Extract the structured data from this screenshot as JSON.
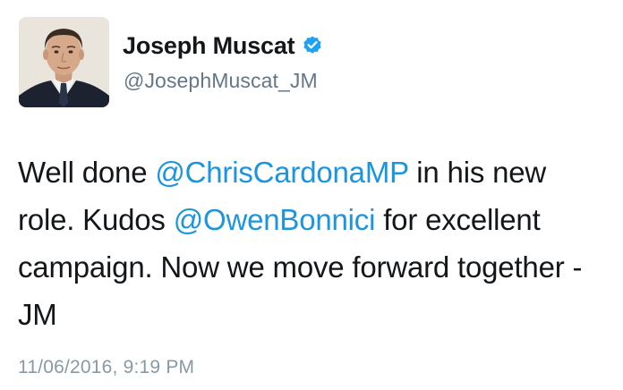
{
  "tweet": {
    "author": {
      "display_name": "Joseph Muscat",
      "handle": "@JosephMuscat_JM",
      "verified": true,
      "avatar_icon": "profile-photo"
    },
    "text_segments": [
      {
        "text": "Well done ",
        "type": "text"
      },
      {
        "text": "@ChrisCardonaMP",
        "type": "mention"
      },
      {
        "text": " in his new role. Kudos ",
        "type": "text"
      },
      {
        "text": "@OwenBonnici",
        "type": "mention"
      },
      {
        "text": " for excellent campaign. Now we move forward together -JM",
        "type": "text"
      }
    ],
    "timestamp": "11/06/2016, 9:19 PM"
  },
  "colors": {
    "mention": "#1b95e0",
    "verified_badge": "#1da1f2",
    "handle": "#657786",
    "timestamp": "#8899a6",
    "text": "#14171a"
  }
}
